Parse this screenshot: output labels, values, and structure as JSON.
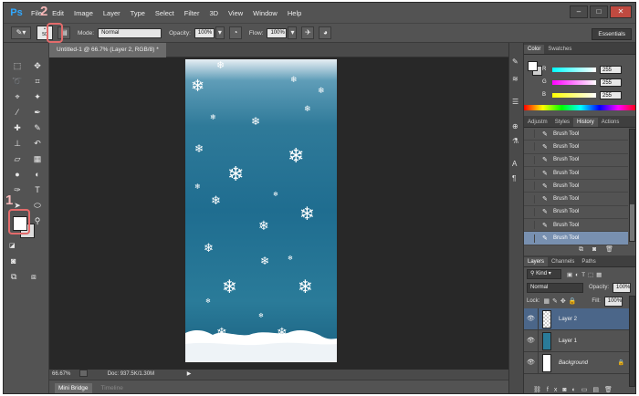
{
  "app": {
    "logo": "Ps"
  },
  "menu": [
    "File",
    "Edit",
    "Image",
    "Layer",
    "Type",
    "Select",
    "Filter",
    "3D",
    "View",
    "Window",
    "Help"
  ],
  "window_controls": [
    "–",
    "□",
    "✕"
  ],
  "options_bar": {
    "brush_size": "50",
    "mode_label": "Mode:",
    "mode_value": "Normal",
    "opacity_label": "Opacity:",
    "opacity_value": "100%",
    "flow_label": "Flow:",
    "flow_value": "100%",
    "workspace": "Essentials"
  },
  "annotations": {
    "step1": "1",
    "step2": "2"
  },
  "document": {
    "tab_title": "Untitled-1 @ 66.7% (Layer 2, RGB/8) *",
    "zoom": "66.67%",
    "doc_info": "Doc: 937.5K/1.30M"
  },
  "bottom_tabs": [
    "Mini Bridge",
    "Timeline"
  ],
  "color_panel": {
    "tabs": [
      "Color",
      "Swatches"
    ],
    "channels": [
      {
        "label": "R",
        "value": "255"
      },
      {
        "label": "G",
        "value": "255"
      },
      {
        "label": "B",
        "value": "255"
      }
    ]
  },
  "history_panel": {
    "tabs": [
      "Adjustm",
      "Styles",
      "History",
      "Actions"
    ],
    "items": [
      "Brush Tool",
      "Brush Tool",
      "Brush Tool",
      "Brush Tool",
      "Brush Tool",
      "Brush Tool",
      "Brush Tool",
      "Brush Tool",
      "Brush Tool"
    ]
  },
  "layers_panel": {
    "tabs": [
      "Layers",
      "Channels",
      "Paths"
    ],
    "filter_kind": "Kind",
    "blend_mode": "Normal",
    "opacity_label": "Opacity:",
    "opacity_value": "100%",
    "lock_label": "Lock:",
    "fill_label": "Fill:",
    "fill_value": "100%",
    "layers": [
      "Layer 2",
      "Layer 1",
      "Background"
    ]
  },
  "colors": {
    "selection_blue": "#7890b0",
    "layer_selected": "#4b6689",
    "annotation": "#e36b6b"
  }
}
